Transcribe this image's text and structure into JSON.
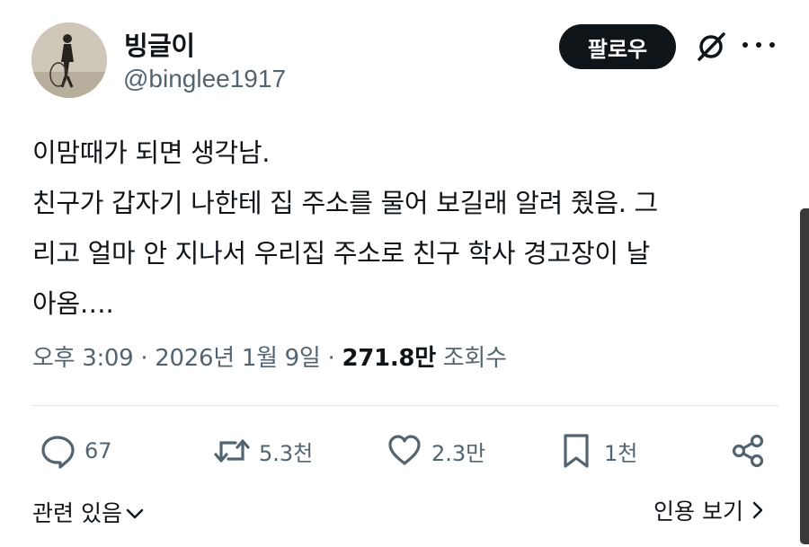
{
  "author": {
    "display_name": "빙글이",
    "handle": "@binglee1917",
    "avatar": "avatar-photo-man-with-hoop"
  },
  "header": {
    "follow_label": "팔로우",
    "grok_icon": "grok-slash-icon",
    "more_icon": "more-dots-icon"
  },
  "tweet": {
    "text": "이맘때가 되면 생각남.\n친구가 갑자기 나한테 집 주소를 물어 보길래 알려 줬음. 그\n리고 얼마 안 지나서 우리집 주소로 친구 학사 경고장이 날\n아옴….",
    "time": "오후 3:09",
    "date": "2026년 1월 9일",
    "separator": "·",
    "views_count": "271.8만",
    "views_label": "조회수"
  },
  "actions": {
    "replies": "67",
    "reposts": "5.3천",
    "likes": "2.3만",
    "bookmarks": "1천"
  },
  "footer": {
    "related_label": "관련 있음",
    "quotes_label": "인용 보기"
  },
  "colors": {
    "text": "#0f1419",
    "secondary": "#536471",
    "button_bg": "#0f1419"
  }
}
